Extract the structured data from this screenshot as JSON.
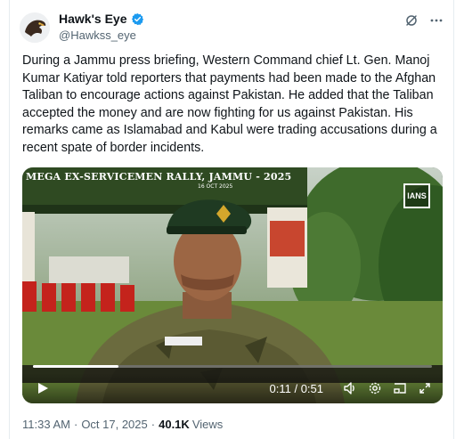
{
  "author": {
    "name": "Hawk's Eye",
    "handle": "@Hawkss_eye",
    "verified": true
  },
  "tweet": {
    "text": "During a Jammu press briefing, Western Command chief Lt. Gen. Manoj Kumar Katiyar told reporters that payments had been made to the Afghan Taliban to encourage actions against Pakistan. He added that the Taliban accepted the money and are now fighting for us against Pakistan. His remarks came as Islamabad and Kabul were trading accusations during a recent spate of border incidents."
  },
  "video": {
    "banner_text": "MEGA EX-SERVICEMEN RALLY, JAMMU - 2025",
    "banner_subtext": "16 OCT 2025",
    "watermark": "IANS",
    "time_display": "0:11 / 0:51",
    "progress_fraction": 0.215,
    "icons": [
      "play-icon",
      "volume-icon",
      "settings-icon",
      "picture-in-picture-icon",
      "fullscreen-icon"
    ]
  },
  "meta": {
    "time": "11:33 AM",
    "separator": "·",
    "date": "Oct 17, 2025",
    "views_count": "40.1K",
    "views_label": "Views"
  },
  "colors": {
    "verified_badge": "#1d9bf0",
    "text_primary": "#0f1419",
    "text_secondary": "#536471"
  }
}
